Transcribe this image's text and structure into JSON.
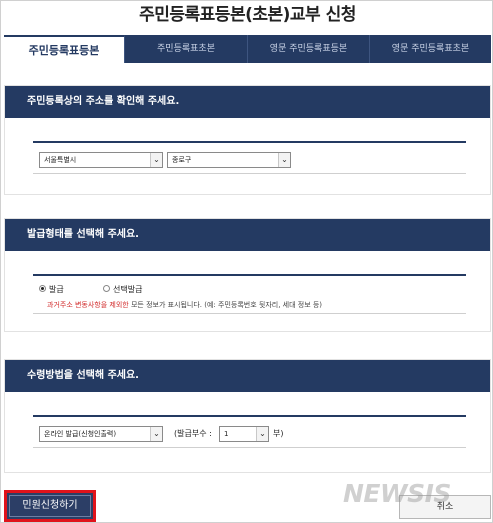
{
  "page": {
    "title": "주민등록표등본(초본)교부 신청"
  },
  "tabs": [
    {
      "label": "주민등록표등본",
      "active": true
    },
    {
      "label": "주민등록표초본",
      "active": false
    },
    {
      "label": "영문 주민등록표등본",
      "active": false
    },
    {
      "label": "영문 주민등록표초본",
      "active": false
    }
  ],
  "address_section": {
    "heading": "주민등록상의 주소를 확인해 주세요.",
    "city_select": "서울특별시",
    "district_select": "종로구"
  },
  "issue_section": {
    "heading": "발급형태를 선택해 주세요.",
    "option_full": "발급",
    "option_select": "선택발급",
    "selected": "발급",
    "notice_red": "과거주소 변동사항을 제외한",
    "notice_rest": " 모든 정보가 표시됩니다. (예: 주민등록번호 뒷자리, 세대 정보 등)"
  },
  "receive_section": {
    "heading": "수령방법을 선택해 주세요.",
    "method_select": "온라인 발급(신청인출력)",
    "copies_label_open": "(발급부수 :",
    "copies_value": "1",
    "copies_label_close": "부)"
  },
  "buttons": {
    "apply": "민원신청하기",
    "cancel": "취소"
  },
  "watermark": "NEWSIS",
  "colors": {
    "navy": "#243a62",
    "highlight_red": "#e0131b",
    "notice_red": "#d22c2c"
  }
}
